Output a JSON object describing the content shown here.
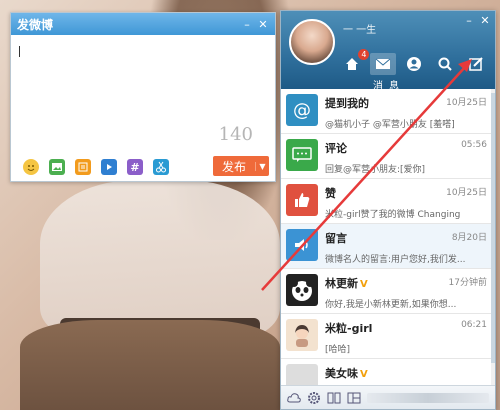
{
  "compose": {
    "title": "发微博",
    "counter": "140",
    "publish_label": "发布",
    "tool_icons": [
      "smile-icon",
      "image-icon",
      "topic-icon",
      "video-icon",
      "hashtag-icon",
      "scissors-icon"
    ]
  },
  "panel": {
    "username": "一 一生",
    "nav": [
      {
        "name": "home-icon",
        "badge": "4"
      },
      {
        "name": "message-icon",
        "badge": ""
      },
      {
        "name": "profile-icon",
        "badge": ""
      },
      {
        "name": "search-icon",
        "badge": ""
      },
      {
        "name": "compose-icon",
        "badge": ""
      }
    ],
    "nav_caption": "消息",
    "items": [
      {
        "title": "提到我的",
        "time": "10月25日",
        "preview": "@猫机小子 @军营小朋友 [羞嗒]",
        "vip": false,
        "icon": "at-icon",
        "color": "#2f8fc2"
      },
      {
        "title": "评论",
        "time": "05:56",
        "preview": "回复@军营小朋友:[爱你]",
        "vip": false,
        "icon": "comment-icon",
        "color": "#3aa94a"
      },
      {
        "title": "赞",
        "time": "10月25日",
        "preview": "米粒-girl赞了我的微博 Changing",
        "vip": false,
        "icon": "like-icon",
        "color": "#e0513f"
      },
      {
        "title": "留言",
        "time": "8月20日",
        "preview": "微博名人的留言:用户您好,我们发...",
        "vip": false,
        "icon": "speaker-icon",
        "color": "#3b93d4"
      },
      {
        "title": "林更新",
        "time": "17分钟前",
        "preview": "你好,我是小新林更新,如果你想...",
        "vip": true,
        "icon": "panda-avatar-icon",
        "color": "#222"
      },
      {
        "title": "米粒-girl",
        "time": "06:21",
        "preview": "[哈哈]",
        "vip": false,
        "icon": "girl-avatar-icon",
        "color": "#f3e2cf"
      },
      {
        "title": "美女味",
        "time": "",
        "preview": "",
        "vip": true,
        "icon": "user-avatar-icon",
        "color": "#ddd"
      }
    ],
    "footer_icons": [
      "weather-icon",
      "settings-icon",
      "apps-icon",
      "layout-icon"
    ]
  },
  "colors": {
    "accent": "#3f97d6",
    "publish": "#ef6a3a",
    "arrow": "#e63a3a"
  }
}
